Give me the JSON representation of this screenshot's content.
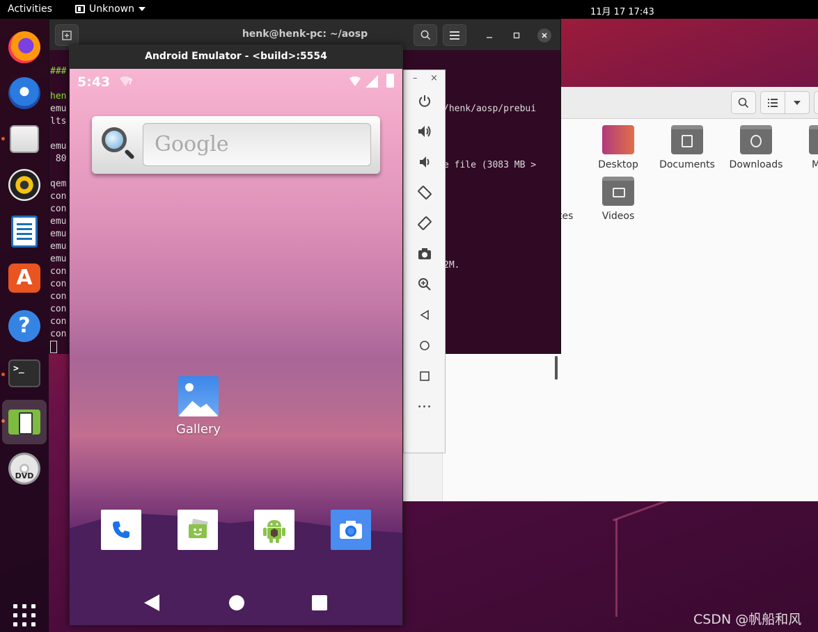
{
  "topbar": {
    "activities": "Activities",
    "app_menu": "Unknown",
    "clock": "11月 17  17:43"
  },
  "dock": {
    "items": [
      {
        "name": "firefox",
        "icon": "firefox-icon"
      },
      {
        "name": "thunderbird",
        "icon": "thunderbird-icon"
      },
      {
        "name": "files",
        "icon": "files-icon",
        "running": true
      },
      {
        "name": "rhythmbox",
        "icon": "rhythmbox-icon"
      },
      {
        "name": "libreoffice-writer",
        "icon": "writer-icon"
      },
      {
        "name": "ubuntu-software",
        "icon": "software-store-icon"
      },
      {
        "name": "help",
        "icon": "help-icon"
      },
      {
        "name": "terminal",
        "icon": "terminal-icon",
        "running": true
      },
      {
        "name": "android-emulator",
        "icon": "emulator-icon",
        "running": true,
        "active": true
      },
      {
        "name": "dvd",
        "icon": "dvd-icon"
      }
    ],
    "help_glyph": "?",
    "store_glyph": "A",
    "terminal_glyph": ">_",
    "dvd_text": "DVD"
  },
  "terminal": {
    "title": "henk@henk-pc: ~/aosp",
    "lines_left": [
      {
        "text": "###",
        "color": "green"
      },
      {
        "text": "",
        "color": "plain"
      },
      {
        "text": "hen",
        "color": "green"
      },
      {
        "text": "emu",
        "color": "plain"
      },
      {
        "text": "lts",
        "color": "plain"
      },
      {
        "text": "",
        "color": "plain"
      },
      {
        "text": "emu",
        "color": "plain"
      },
      {
        "text": " 80",
        "color": "plain"
      },
      {
        "text": "",
        "color": "plain"
      },
      {
        "text": "qem",
        "color": "plain"
      },
      {
        "text": "con",
        "color": "plain"
      },
      {
        "text": "con",
        "color": "plain"
      },
      {
        "text": "emu",
        "color": "plain"
      },
      {
        "text": "emu",
        "color": "plain"
      },
      {
        "text": "emu",
        "color": "plain"
      },
      {
        "text": "emu",
        "color": "plain"
      },
      {
        "text": "con",
        "color": "plain"
      },
      {
        "text": "con",
        "color": "plain"
      },
      {
        "text": "con",
        "color": "plain"
      },
      {
        "text": "con",
        "color": "plain"
      },
      {
        "text": "con",
        "color": "plain"
      },
      {
        "text": "con",
        "color": "plain"
      }
    ],
    "lines_right": [
      "/henk/aosp/prebui",
      "e file (3083 MB >",
      "2M."
    ]
  },
  "files": {
    "folders": [
      {
        "label": "Desktop"
      },
      {
        "label": "Documents"
      },
      {
        "label": "Downloads"
      },
      {
        "label": "M"
      },
      {
        "label": "tes"
      },
      {
        "label": "Videos"
      }
    ]
  },
  "emulator": {
    "title": "Android Emulator - <build>:5554",
    "status_time": "5:43",
    "wifi_question": "?",
    "search_placeholder": "Google",
    "gallery_label": "Gallery",
    "hotseat": [
      "phone-icon",
      "messaging-icon",
      "android-app-icon",
      "camera-icon"
    ],
    "toolbar": [
      "power-icon",
      "volume-up-icon",
      "volume-down-icon",
      "rotate-left-icon",
      "rotate-right-icon",
      "screenshot-icon",
      "zoom-icon",
      "back-icon",
      "home-icon",
      "overview-icon",
      "more-icon"
    ],
    "toolbar_minimize": "–",
    "toolbar_close": "×",
    "more_glyph": "•••"
  },
  "watermark": "CSDN @帆船和风"
}
